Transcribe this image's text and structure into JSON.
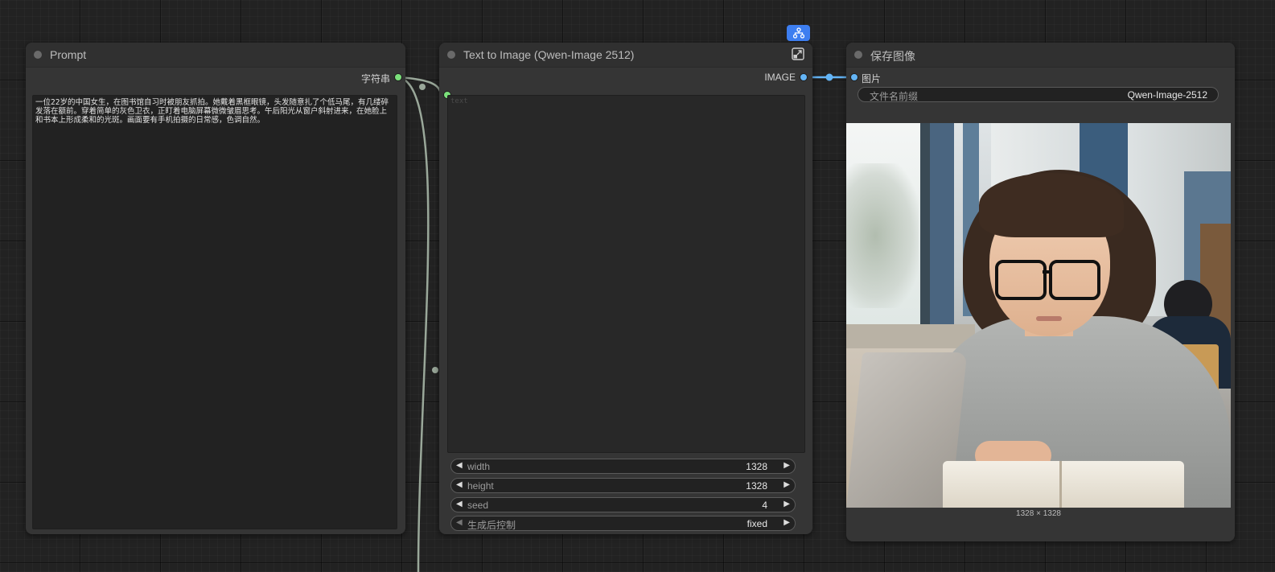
{
  "nodes": {
    "prompt": {
      "title": "Prompt",
      "output_label": "字符串",
      "text": "一位22岁的中国女生，在图书馆自习时被朋友抓拍。她戴着黑框眼镜，头发随意扎了个低马尾，有几缕碎发落在额前。穿着简单的灰色卫衣，正盯着电脑屏幕微微皱眉思考。午后阳光从窗户斜射进来，在她脸上和书本上形成柔和的光斑。画面要有手机拍摄的日常感，色调自然。"
    },
    "text_to_image": {
      "title": "Text to Image (Qwen-Image 2512)",
      "output_label": "IMAGE",
      "text_placeholder": "text",
      "widgets": [
        {
          "label": "width",
          "value": "1328"
        },
        {
          "label": "height",
          "value": "1328"
        },
        {
          "label": "seed",
          "value": "4"
        },
        {
          "label": "生成后控制",
          "value": "fixed"
        }
      ]
    },
    "save_image": {
      "title": "保存图像",
      "input_label": "图片",
      "filename_prefix": {
        "label": "文件名前缀",
        "value": "Qwen-Image-2512"
      },
      "image_caption": "1328 × 1328"
    }
  },
  "icons": {
    "subgraph_badge": "subgraph-icon",
    "expand": "expand-icon"
  },
  "colors": {
    "canvas": "#222222",
    "node_body": "#353535",
    "string_slot": "#7be07b",
    "image_slot": "#64b5f6",
    "badge": "#3d7ef0",
    "link_string": "#9aa89a"
  }
}
